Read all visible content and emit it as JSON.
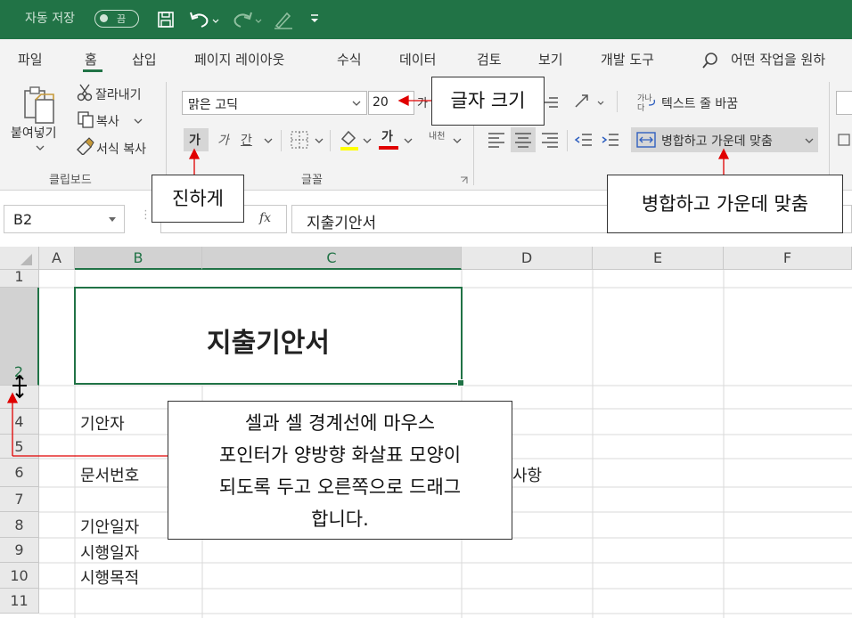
{
  "title_bar": {
    "autosave_label": "자동 저장",
    "autosave_state": "끔",
    "icons": [
      "save-icon",
      "undo-icon",
      "redo-icon",
      "pen-icon",
      "customize-icon"
    ]
  },
  "ribbon_tabs": [
    "파일",
    "홈",
    "삽입",
    "페이지 레이아웃",
    "수식",
    "데이터",
    "검토",
    "보기",
    "개발 도구"
  ],
  "tell_me": "어떤 작업을 원하",
  "clipboard": {
    "paste": "붙여넣기",
    "cut": "잘라내기",
    "copy": "복사",
    "format_painter": "서식 복사",
    "group_label": "클립보드"
  },
  "font": {
    "font_name": "맑은 고딕",
    "font_size": "20",
    "bold": "가",
    "italic": "가",
    "underline": "간",
    "font_color": "가",
    "phonetic": "내천",
    "group_label": "글꼴"
  },
  "alignment": {
    "wrap_text": "텍스트 줄 바꿈",
    "merge_center": "병합하고 가운데 맞춤"
  },
  "formula_bar": {
    "name_box": "B2",
    "fx": "fx",
    "content": "지출기안서"
  },
  "columns": [
    "A",
    "B",
    "C",
    "D",
    "E",
    "F"
  ],
  "rows": [
    "1",
    "2",
    "",
    "4",
    "5",
    "6",
    "7",
    "8",
    "9",
    "10",
    "11"
  ],
  "cells": {
    "title": "지출기안서",
    "b4": "기안자",
    "b6": "문서번호",
    "d6": "사항",
    "b8": "기안일자",
    "b9": "시행일자",
    "b10": "시행목적"
  },
  "callouts": {
    "font_size": "글자 크기",
    "bold": "진하게",
    "merge": "병합하고 가운데 맞춤",
    "drag": [
      "셀과 셀 경계선에 마우스",
      "포인터가 양방향 화살표 모양이",
      "되도록 두고 오른쪽으로 드래그",
      "합니다."
    ]
  },
  "colors": {
    "excel_green": "#217346",
    "selection": "#217346",
    "annotation_red": "#e00000"
  }
}
